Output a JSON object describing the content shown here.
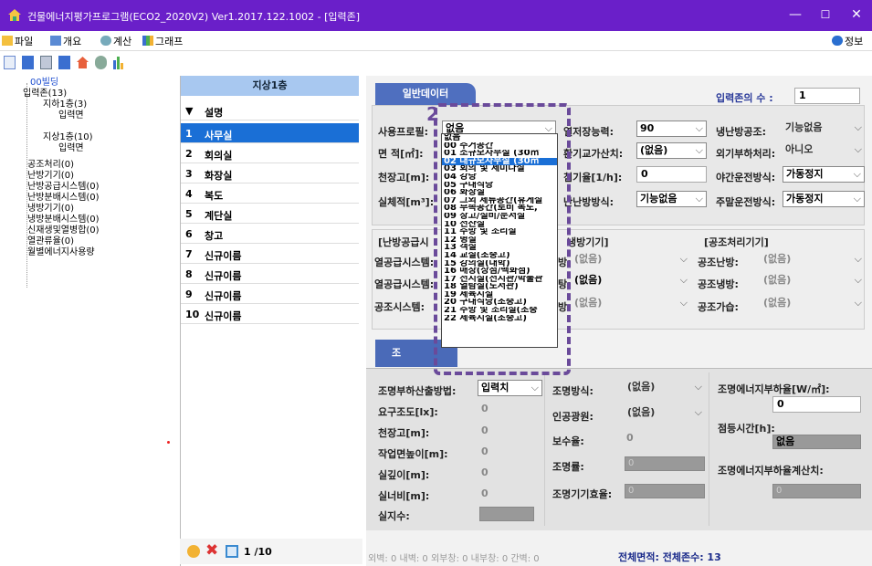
{
  "window": {
    "title": "건물에너지평가프로그램(ECO2_2020V2) Ver1.2017.122.1002 - [입력존]"
  },
  "menu": {
    "file": "파일",
    "overview": "개요",
    "calc": "계산",
    "graph": "그래프",
    "info": "정보"
  },
  "tree": {
    "items": [
      "00빌딩",
      "입력존(13)",
      "지하1층(3)",
      "입력면",
      "지상1층(10)",
      "입력면",
      "공조처리(0)",
      "난방기기(0)",
      "난방공급시스템(0)",
      "난방분배시스템(0)",
      "냉방기기(0)",
      "냉방분배시스템(0)",
      "신재생및열병합(0)",
      "열관류율(0)",
      "월별에너지사용량"
    ]
  },
  "zone_list": {
    "header": "지상1층",
    "col_header": "설명",
    "sort_marker": "▼",
    "rows": [
      {
        "n": "1",
        "t": "사무실"
      },
      {
        "n": "2",
        "t": "회의실"
      },
      {
        "n": "3",
        "t": "화장실"
      },
      {
        "n": "4",
        "t": "복도"
      },
      {
        "n": "5",
        "t": "계단실"
      },
      {
        "n": "6",
        "t": "창고"
      },
      {
        "n": "7",
        "t": "신규이름"
      },
      {
        "n": "8",
        "t": "신규이름"
      },
      {
        "n": "9",
        "t": "신규이름"
      },
      {
        "n": "10",
        "t": "신규이름"
      }
    ],
    "page": "1 /10"
  },
  "general": {
    "tab": "일반데이터",
    "zone_count_label": "입력존의 수 :",
    "zone_count": "1",
    "usage_label": "사용프로필:",
    "usage_value": "없음",
    "area_label": "면 적[㎡]:",
    "ceiling_label": "천장고[m]:",
    "volume_label": "실체적[m³]:",
    "heat_storage_label": "열저장능력:",
    "heat_storage_value": "90",
    "vent_label": "환기교가산치:",
    "vent_value": "(없음)",
    "infil_label": "침기율[1/h]:",
    "infil_value": "0",
    "heating_label": "난난방방식:",
    "heating_value": "기능없음",
    "cool_air_label": "냉난방공조:",
    "cool_air_value": "기능없음",
    "outdoor_label": "외기부하처리:",
    "outdoor_value": "아니오",
    "night_label": "야간운전방식:",
    "night_value": "가동정지",
    "weekend_label": "주말운전방식:",
    "weekend_value": "가동정지",
    "annotation": "2"
  },
  "systems": {
    "left_title": "[난방공급시",
    "mid_title": "냉방기기]",
    "right_title": "[공조처리기기]",
    "rows": [
      {
        "l": "열공급시스템:",
        "m": "방:",
        "mv": "(없음)",
        "r": "공조난방:",
        "rv": "(없음)"
      },
      {
        "l": "열공급시스템:",
        "m": "탕:",
        "mv": "(없음)",
        "r": "공조냉방:",
        "rv": "(없음)"
      },
      {
        "l": "공조시스템:",
        "m": "방:",
        "mv": "(없음)",
        "r": "공조가습:",
        "rv": "(없음)"
      }
    ]
  },
  "lighting": {
    "tab": "조",
    "calc_label": "조명부하산출방법:",
    "calc_value": "입력치",
    "method_label": "조명방식:",
    "method_value": "(없음)",
    "energy_label": "조명에너지부하율[W/㎡]:",
    "energy_value": "0",
    "lux_label": "요구조도[lx]:",
    "lux_value": "0",
    "source_label": "인공광원:",
    "source_value": "(없음)",
    "hours_label": "점등시간[h]:",
    "hours_value": "없음",
    "ceil_label": "천장고[m]:",
    "ceil_value": "0",
    "maint_label": "보수율:",
    "maint_value": "0",
    "work_label": "작업면높이[m]:",
    "work_value": "0",
    "rate_label": "조명률:",
    "rate_value": "0",
    "calc2_label": "조명에너지부하율계산치:",
    "calc2_value": "0",
    "depth_label": "실깊이[m]:",
    "depth_value": "0",
    "eff_label": "조명기기효율:",
    "eff_value": "0",
    "width_label": "실너비[m]:",
    "width_value": "0",
    "index_label": "실지수:"
  },
  "dropdown": {
    "items": [
      "없음",
      "00 주거공간",
      "01 소규모사무실 (30㎡",
      "02 대규모사무실 (30㎡",
      "03 회의 및 세미나실",
      "04 강당",
      "05 구내식당",
      "06 화장실",
      "07 그외 체류공간(휴게실",
      "08 부속공간(로비 복도,",
      "09 창고/설비/문서실",
      "10 전산실",
      "11 주방 및 조리실",
      "12 병실",
      "13 객실",
      "14 교실(초중고)",
      "15 강의실(대학)",
      "16 매장(상점/백화점)",
      "17 전시실(전시관/박물관",
      "18 열람실(도서관)",
      "19 체육시설",
      "20 구내식당(초중고)",
      "21 주방 및 조리실(초중",
      "22 체육시설(초중고)"
    ],
    "selected_index": 3
  },
  "status": {
    "prefix": "외벽: 0  내벽: 0  외부창: 0  내부창: 0  간벽: 0",
    "total": "전체면적:  전체존수: 13"
  }
}
